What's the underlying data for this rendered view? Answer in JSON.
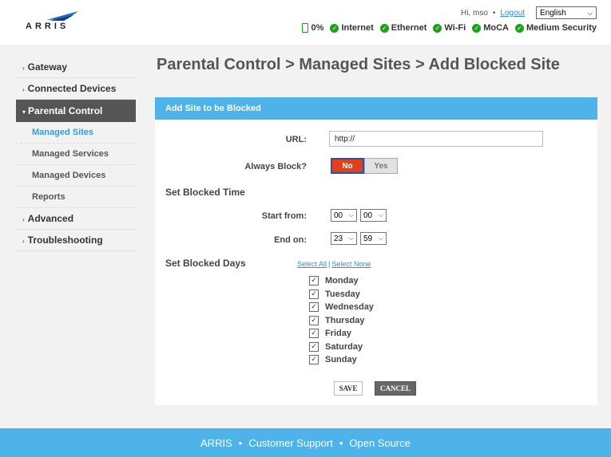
{
  "header": {
    "logo_text": "ARRIS",
    "greeting": "Hi, mso",
    "logout_label": "Logout",
    "language": "English",
    "status": [
      {
        "label": "0%",
        "icon": "battery-icon"
      },
      {
        "label": "Internet",
        "icon": "check-circle-icon"
      },
      {
        "label": "Ethernet",
        "icon": "check-circle-icon"
      },
      {
        "label": "Wi-Fi",
        "icon": "check-circle-icon"
      },
      {
        "label": "MoCA",
        "icon": "check-circle-icon"
      },
      {
        "label": "Medium Security",
        "icon": "check-circle-icon"
      }
    ],
    "colors": {
      "status_ok": "#1aa31a",
      "link": "#2b8fd6"
    }
  },
  "sidebar": {
    "items": [
      {
        "label": "Gateway"
      },
      {
        "label": "Connected Devices"
      },
      {
        "label": "Parental Control"
      },
      {
        "label": "Advanced"
      },
      {
        "label": "Troubleshooting"
      }
    ],
    "sub_items": [
      {
        "label": "Managed Sites"
      },
      {
        "label": "Managed Services"
      },
      {
        "label": "Managed Devices"
      },
      {
        "label": "Reports"
      }
    ],
    "active_color": "#555555",
    "current_sub_color": "#2b9fdc"
  },
  "main": {
    "page_title": "Parental Control > Managed Sites > Add Blocked Site",
    "panel_title": "Add Site to be Blocked",
    "url_label": "URL:",
    "url_value": "http://",
    "always_block_label": "Always Block?",
    "toggle": {
      "no_label": "No",
      "yes_label": "Yes",
      "selected": "No"
    },
    "blocked_time_title": "Set Blocked Time",
    "start_label": "Start from:",
    "start_hour": "00",
    "start_minute": "00",
    "end_label": "End on:",
    "end_hour": "23",
    "end_minute": "59",
    "blocked_days_title": "Set Blocked Days",
    "select_all": "Select All",
    "select_none": "Select None",
    "days": [
      {
        "label": "Monday",
        "checked": true
      },
      {
        "label": "Tuesday",
        "checked": true
      },
      {
        "label": "Wednesday",
        "checked": true
      },
      {
        "label": "Thursday",
        "checked": true
      },
      {
        "label": "Friday",
        "checked": true
      },
      {
        "label": "Saturday",
        "checked": true
      },
      {
        "label": "Sunday",
        "checked": true
      }
    ],
    "save_label": "SAVE",
    "cancel_label": "CANCEL",
    "colors": {
      "panel_header": "#4eb3e8",
      "toggle_on": "#e0401b"
    }
  },
  "footer": {
    "brand": "ARRIS",
    "support": "Customer Support",
    "open_source": "Open Source",
    "color": "#4eb3e8"
  }
}
